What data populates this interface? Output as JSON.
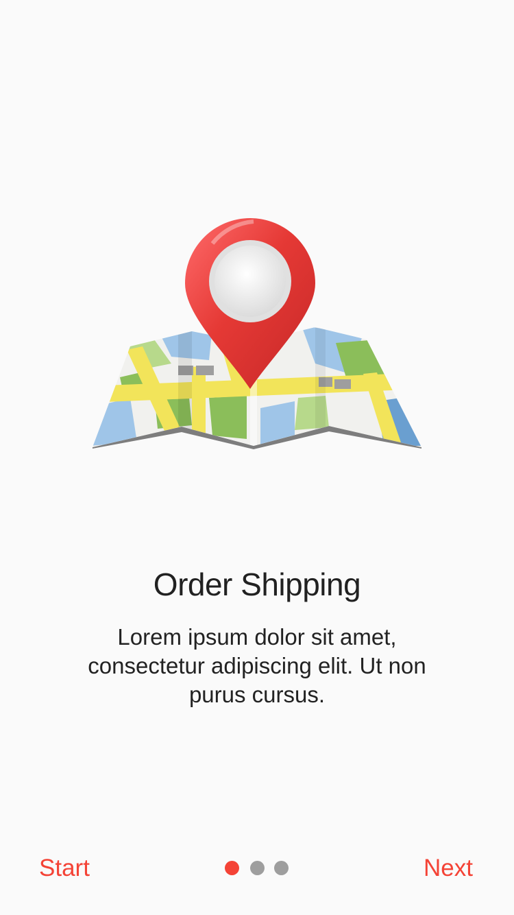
{
  "onboarding": {
    "title": "Order Shipping",
    "description": "Lorem ipsum dolor sit amet, consectetur adipiscing elit. Ut non purus cursus.",
    "illustration_icon": "map-pin-icon",
    "start_label": "Start",
    "next_label": "Next",
    "page_indicator": {
      "total": 3,
      "current": 1,
      "active_color": "#f44336",
      "inactive_color": "#9e9e9e"
    }
  },
  "theme": {
    "accent": "#f44336",
    "background": "#fafafa",
    "text": "#212121"
  }
}
